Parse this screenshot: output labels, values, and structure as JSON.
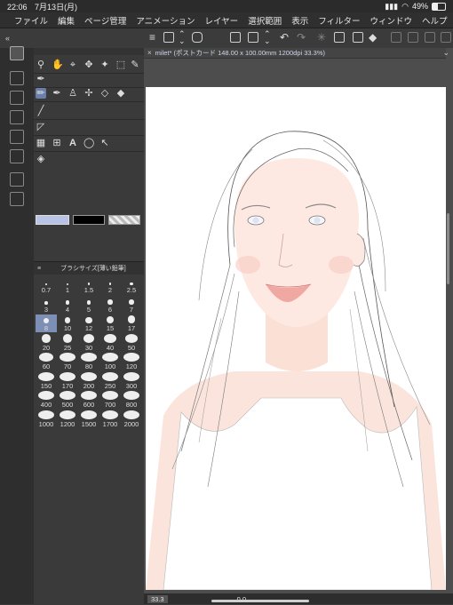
{
  "status_bar": {
    "time": "22:06",
    "date": "7月13日(月)",
    "battery": "49%"
  },
  "menu": {
    "items": [
      "ファイル",
      "編集",
      "ページ管理",
      "アニメーション",
      "レイヤー",
      "選択範囲",
      "表示",
      "フィルター",
      "ウィンドウ",
      "ヘルプ"
    ]
  },
  "document": {
    "tab_title": "milet* (ポストカード 148.00 x 100.00mm 1200dpi 33.3%)"
  },
  "brush_panel": {
    "title": "ブラシサイズ[薄い鉛筆]",
    "sizes": [
      "0.7",
      "1",
      "1.5",
      "2",
      "2.5",
      "3",
      "4",
      "5",
      "6",
      "7",
      "8",
      "10",
      "12",
      "15",
      "17",
      "20",
      "25",
      "30",
      "40",
      "50",
      "60",
      "70",
      "80",
      "100",
      "120",
      "150",
      "170",
      "200",
      "250",
      "300",
      "400",
      "500",
      "600",
      "700",
      "800",
      "1000",
      "1200",
      "1500",
      "1700",
      "2000"
    ],
    "selected": "8"
  },
  "bottom": {
    "zoom": "33.3",
    "rotation": "0.0"
  },
  "colors": {
    "accent": "#7e8fb5",
    "main_color": "#b9c3e6",
    "sub_color": "#000000"
  }
}
